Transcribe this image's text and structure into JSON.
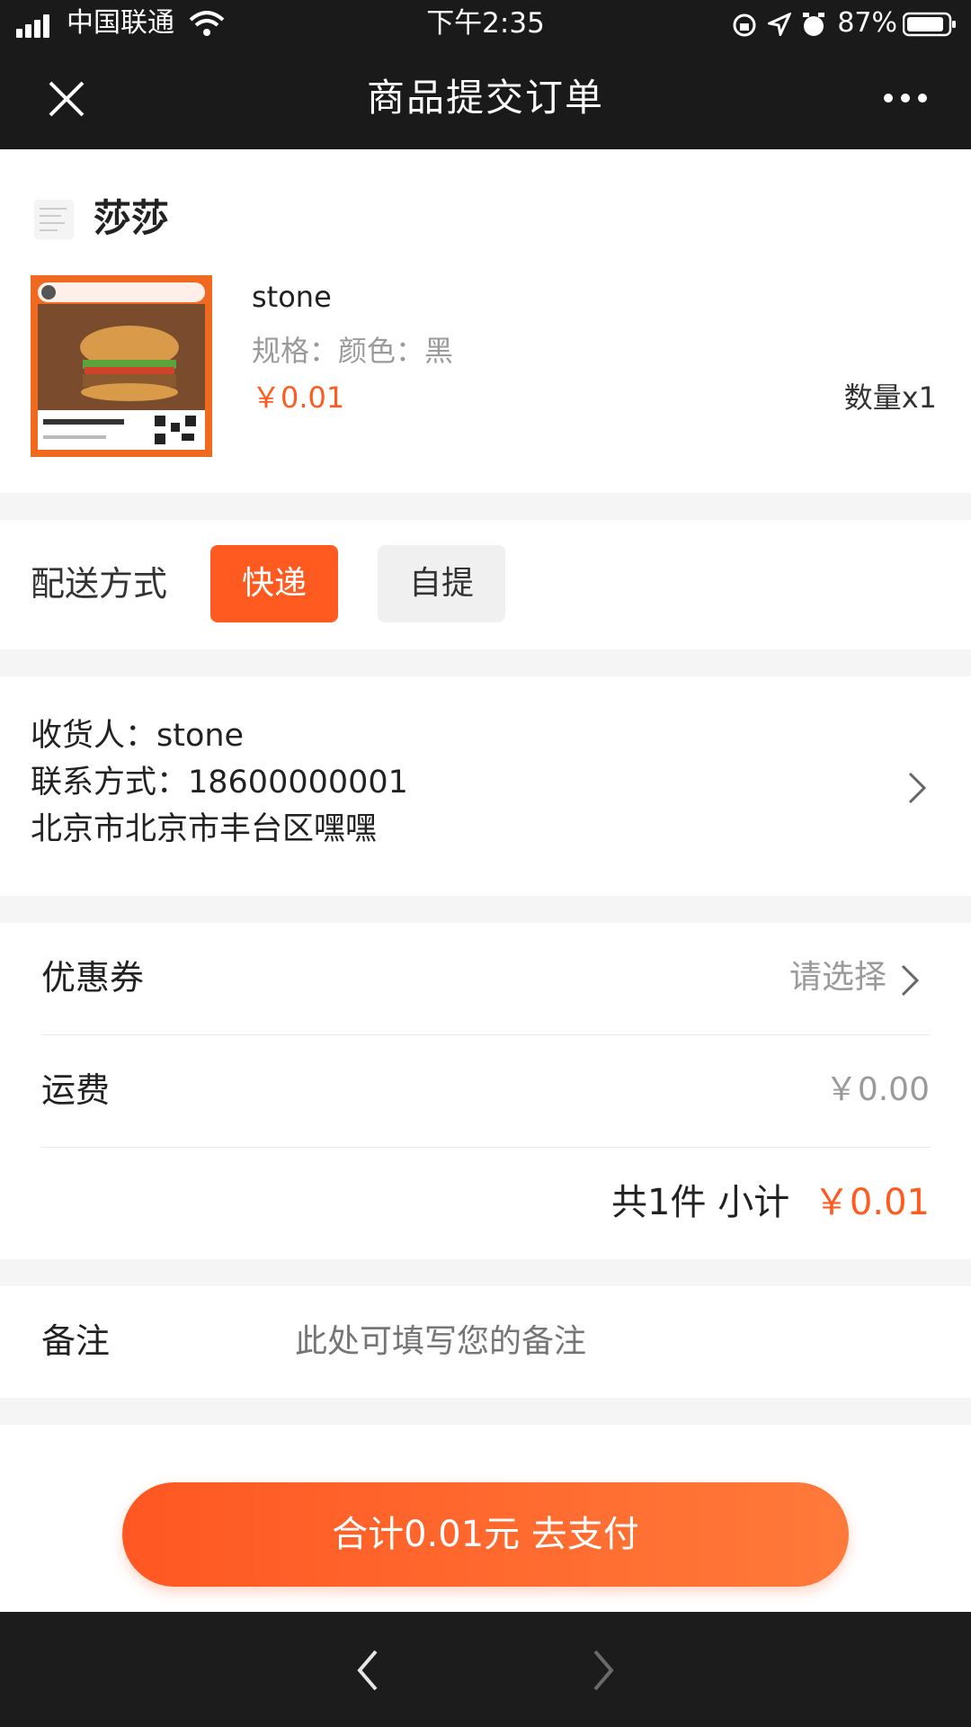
{
  "status_bar": {
    "carrier": "中国联通",
    "time": "下午2:35",
    "battery": "87%"
  },
  "nav": {
    "title": "商品提交订单"
  },
  "shop": {
    "name": "莎莎"
  },
  "product": {
    "title": "stone",
    "spec": "规格：颜色：黑",
    "price": "￥0.01",
    "quantity": "数量x1"
  },
  "delivery": {
    "label": "配送方式",
    "options": [
      "快递",
      "自提"
    ],
    "selected": "快递"
  },
  "address": {
    "receiver": "收货人：stone",
    "contact": "联系方式：18600000001",
    "address": "北京市北京市丰台区嘿嘿"
  },
  "coupon": {
    "label": "优惠券",
    "value": "请选择"
  },
  "shipping": {
    "label": "运费",
    "value": "￥0.00"
  },
  "summary": {
    "count_text": "共1件 小计",
    "subtotal": "￥0.01"
  },
  "remark": {
    "label": "备注",
    "placeholder": "此处可填写您的备注"
  },
  "pay_button": {
    "label": "合计0.01元 去支付"
  },
  "colors": {
    "accent": "#ff5a1f",
    "header_bg": "#1a1a1a",
    "muted_text": "#9a9a9a"
  }
}
